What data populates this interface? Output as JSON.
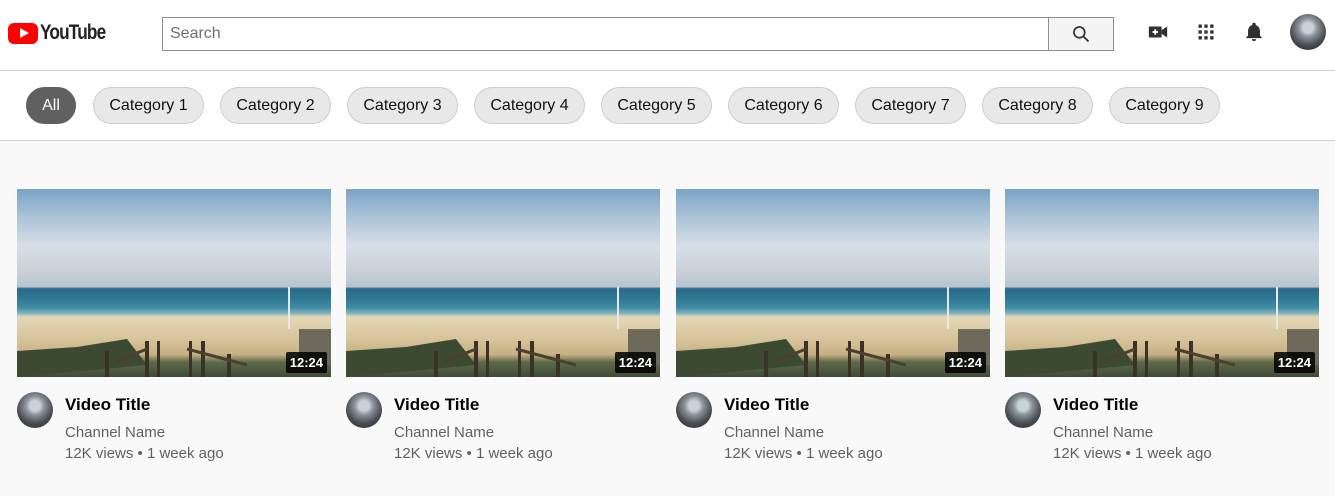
{
  "header": {
    "logo_text": "YouTube",
    "search_placeholder": "Search",
    "icons": [
      "search-icon",
      "create-video-icon",
      "apps-grid-icon",
      "notifications-bell-icon",
      "user-avatar"
    ]
  },
  "chips": [
    {
      "label": "All",
      "active": true
    },
    {
      "label": "Category 1",
      "active": false
    },
    {
      "label": "Category 2",
      "active": false
    },
    {
      "label": "Category 3",
      "active": false
    },
    {
      "label": "Category 4",
      "active": false
    },
    {
      "label": "Category 5",
      "active": false
    },
    {
      "label": "Category 6",
      "active": false
    },
    {
      "label": "Category 7",
      "active": false
    },
    {
      "label": "Category 8",
      "active": false
    },
    {
      "label": "Category 9",
      "active": false
    }
  ],
  "videos": [
    {
      "title": "Video Title",
      "channel": "Channel Name",
      "stats": "12K views • 1 week ago",
      "duration": "12:24"
    },
    {
      "title": "Video Title",
      "channel": "Channel Name",
      "stats": "12K views • 1 week ago",
      "duration": "12:24"
    },
    {
      "title": "Video Title",
      "channel": "Channel Name",
      "stats": "12K views • 1 week ago",
      "duration": "12:24"
    },
    {
      "title": "Video Title",
      "channel": "Channel Name",
      "stats": "12K views • 1 week ago",
      "duration": "12:24"
    }
  ],
  "colors": {
    "brand_red": "#ff0000",
    "chip_active_bg": "#606060",
    "chip_bg": "#e8e8e8",
    "page_bg": "#f9f9f9",
    "secondary_text": "#606060"
  }
}
